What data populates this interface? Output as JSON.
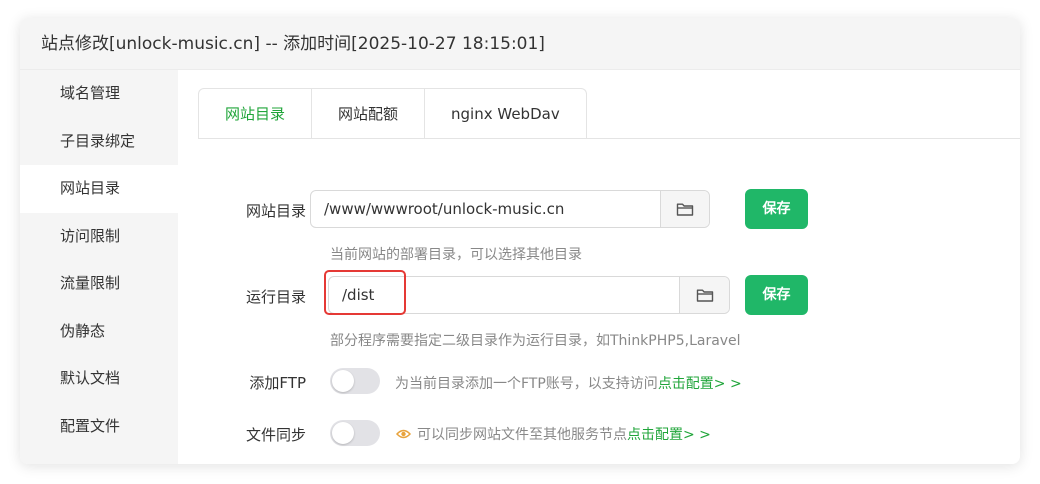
{
  "title": "站点修改[unlock-music.cn] -- 添加时间[2025-10-27 18:15:01]",
  "sidebar": {
    "items": [
      {
        "label": "域名管理"
      },
      {
        "label": "子目录绑定"
      },
      {
        "label": "网站目录"
      },
      {
        "label": "访问限制"
      },
      {
        "label": "流量限制"
      },
      {
        "label": "伪静态"
      },
      {
        "label": "默认文档"
      },
      {
        "label": "配置文件"
      }
    ],
    "active": "网站目录"
  },
  "tabs": [
    {
      "label": "网站目录"
    },
    {
      "label": "网站配额"
    },
    {
      "label": "nginx WebDav"
    }
  ],
  "form": {
    "site_dir": {
      "label": "网站目录",
      "value": "/www/wwwroot/unlock-music.cn",
      "save_label": "保存",
      "hint": "当前网站的部署目录，可以选择其他目录"
    },
    "run_dir": {
      "label": "运行目录",
      "value": "/dist",
      "save_label": "保存",
      "hint": "部分程序需要指定二级目录作为运行目录，如ThinkPHP5,Laravel"
    },
    "ftp": {
      "label": "添加FTP",
      "enabled": false,
      "hint": "为当前目录添加一个FTP账号，以支持访问",
      "link": "点击配置> >"
    },
    "sync": {
      "label": "文件同步",
      "enabled": false,
      "hint": "可以同步网站文件至其他服务节点",
      "link": "点击配置> >"
    }
  },
  "colors": {
    "accent": "#20a53a",
    "save_button": "#20b768",
    "highlight": "#e53935",
    "sync_icon": "#e8a33d"
  },
  "icons": {
    "folder": "folder-icon",
    "sync": "eye-icon"
  }
}
